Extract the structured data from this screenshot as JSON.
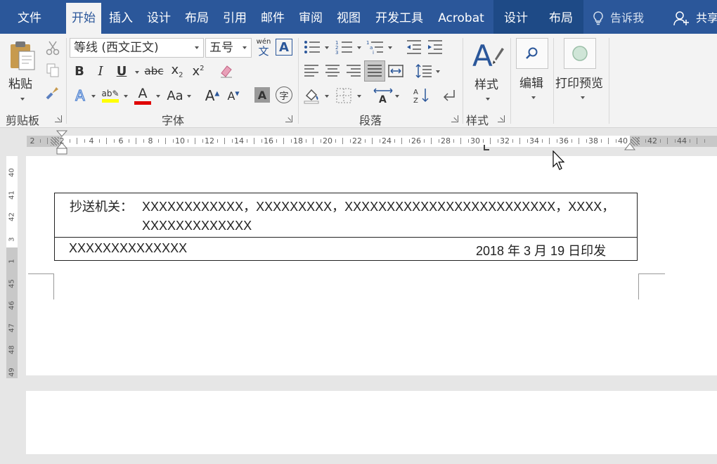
{
  "tabs": [
    "文件",
    "开始",
    "插入",
    "设计",
    "布局",
    "引用",
    "邮件",
    "审阅",
    "视图",
    "开发工具",
    "Acrobat",
    "设计",
    "布局"
  ],
  "tell_me": "告诉我",
  "share": "共享",
  "ribbon": {
    "paste": "粘贴",
    "clipboard_group": "剪贴板",
    "font_name": "等线 (西文正文)",
    "font_size": "五号",
    "wen": "wén",
    "wen_char": "文",
    "font_group": "字体",
    "paragraph_group": "段落",
    "styles": "样式",
    "styles_group": "样式",
    "edit": "编辑",
    "print_preview": "打印预览",
    "aa_label": "Aa"
  },
  "ruler": {
    "h_numbers": [
      "2",
      "2",
      "4",
      "6",
      "8",
      "10",
      "12",
      "14",
      "16",
      "18",
      "20",
      "22",
      "24",
      "26",
      "28",
      "30",
      "32",
      "34",
      "36",
      "38",
      "40",
      "42",
      "44"
    ],
    "v_numbers": [
      "40",
      "41",
      "42",
      "3",
      "1",
      "45",
      "46",
      "47",
      "48",
      "49"
    ]
  },
  "document": {
    "cc_label": "抄送机关：",
    "cc_line1": "XXXXXXXXXXXX，XXXXXXXXX，XXXXXXXXXXXXXXXXXXXXXXXXX，XXXX，",
    "cc_line2": "XXXXXXXXXXXXX",
    "issuer": "XXXXXXXXXXXXXX",
    "date": "2018 年 3 月 19 日印发"
  },
  "colors": {
    "accent": "#2b579a",
    "highlight": "#ffff00",
    "font_color": "#e00000"
  }
}
